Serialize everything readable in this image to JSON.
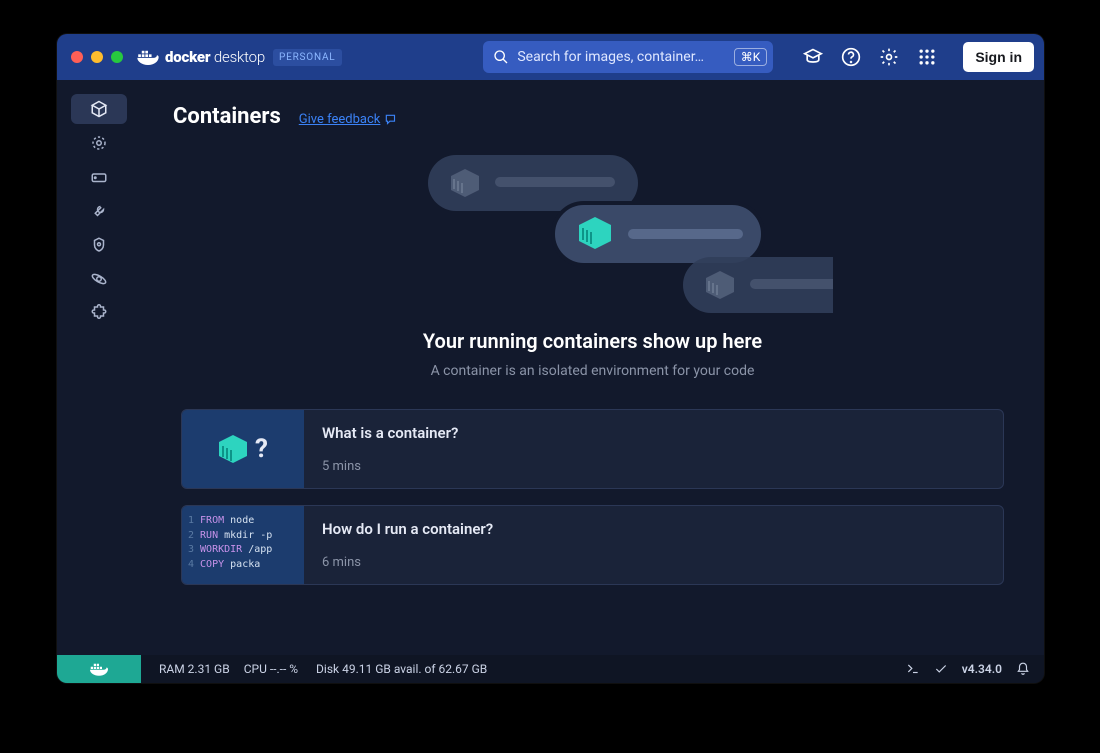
{
  "titlebar": {
    "brand_prefix": "docker",
    "brand_suffix": "desktop",
    "badge": "PERSONAL",
    "search_placeholder": "Search for images, container…",
    "search_shortcut": "⌘K",
    "signin_label": "Sign in"
  },
  "sidebar": {
    "items": [
      {
        "name": "containers",
        "active": true,
        "icon": "cube"
      },
      {
        "name": "images",
        "active": false,
        "icon": "target"
      },
      {
        "name": "volumes",
        "active": false,
        "icon": "drive"
      },
      {
        "name": "dev-environments",
        "active": false,
        "icon": "wrench"
      },
      {
        "name": "scout",
        "active": false,
        "icon": "atom"
      },
      {
        "name": "learn",
        "active": false,
        "icon": "orbit"
      },
      {
        "name": "extensions",
        "active": false,
        "icon": "puzzle"
      }
    ]
  },
  "page": {
    "title": "Containers",
    "feedback_label": "Give feedback"
  },
  "empty_state": {
    "title": "Your running containers show up here",
    "subtitle": "A container is an isolated environment for your code"
  },
  "cards": [
    {
      "title": "What is a container?",
      "duration": "5 mins",
      "thumb_kind": "container-question"
    },
    {
      "title": "How do I run a container?",
      "duration": "6 mins",
      "thumb_kind": "code",
      "code": [
        {
          "n": "1",
          "kw": "FROM",
          "ar": "node"
        },
        {
          "n": "2",
          "kw": "RUN",
          "ar": "mkdir -p"
        },
        {
          "n": "3",
          "kw": "WORKDIR",
          "ar": "/app"
        },
        {
          "n": "4",
          "kw": "COPY",
          "ar": "packa"
        }
      ]
    }
  ],
  "statusbar": {
    "ram": "RAM 2.31 GB",
    "cpu": "CPU --.-- %",
    "disk": "Disk 49.11 GB avail. of 62.67 GB",
    "version": "v4.34.0"
  }
}
